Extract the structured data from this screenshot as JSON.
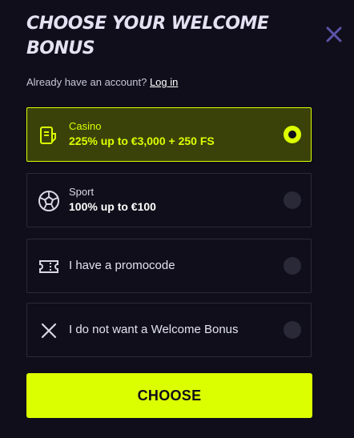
{
  "modal": {
    "title": "CHOOSE YOUR WELCOME BONUS",
    "close_icon": "close-icon",
    "account_prompt": "Already have an account?",
    "login_link": "Log in",
    "options": [
      {
        "label": "Casino",
        "detail": "225% up to €3,000 + 250 FS",
        "icon": "casino-icon",
        "selected": true
      },
      {
        "label": "Sport",
        "detail": "100% up to €100",
        "icon": "soccer-ball-icon",
        "selected": false
      },
      {
        "label": "I have a promocode",
        "icon": "ticket-icon",
        "selected": false
      },
      {
        "label": "I do not want a Welcome Bonus",
        "icon": "x-icon",
        "selected": false
      }
    ],
    "choose_button": "CHOOSE"
  },
  "colors": {
    "background": "#0f0e1a",
    "accent": "#dcff00",
    "selected_bg": "#3a420a",
    "close_icon": "#5b54a8"
  }
}
